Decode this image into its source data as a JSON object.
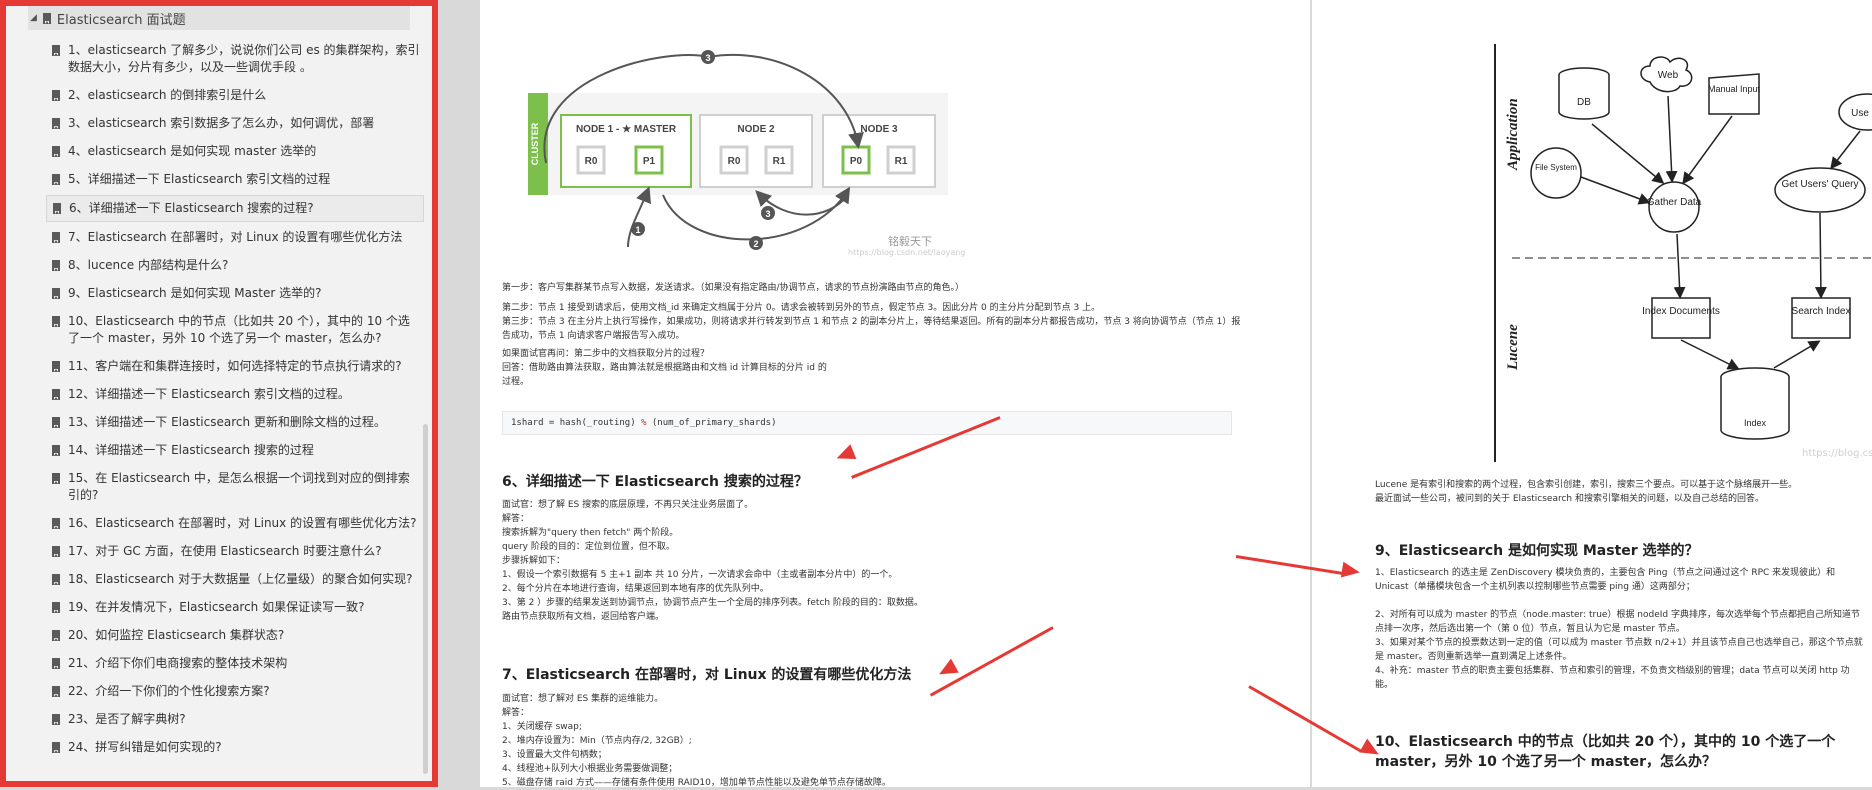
{
  "sidebar": {
    "header": "Elasticsearch 面试题",
    "items": [
      "1、elasticsearch 了解多少，说说你们公司 es 的集群架构，索引数据大小，分片有多少，以及一些调优手段 。",
      "2、elasticsearch 的倒排索引是什么",
      "3、elasticsearch 索引数据多了怎么办，如何调优，部署",
      "4、elasticsearch 是如何实现 master 选举的",
      "5、详细描述一下 Elasticsearch 索引文档的过程",
      "6、详细描述一下 Elasticsearch 搜索的过程?",
      "7、Elasticsearch 在部署时，对 Linux 的设置有哪些优化方法",
      "8、lucence 内部结构是什么?",
      "9、Elasticsearch 是如何实现 Master 选举的?",
      "10、Elasticsearch 中的节点（比如共 20 个），其中的 10 个选了一个 master，另外 10 个选了另一个 master，怎么办?",
      "11、客户端在和集群连接时，如何选择特定的节点执行请求的?",
      "12、详细描述一下 Elasticsearch 索引文档的过程。",
      "13、详细描述一下 Elasticsearch 更新和删除文档的过程。",
      "14、详细描述一下 Elasticsearch 搜索的过程",
      "15、在 Elasticsearch 中，是怎么根据一个词找到对应的倒排索引的?",
      "16、Elasticsearch 在部署时，对 Linux 的设置有哪些优化方法?",
      "17、对于 GC 方面，在使用 Elasticsearch 时要注意什么?",
      "18、Elasticsearch 对于大数据量（上亿量级）的聚合如何实现?",
      "19、在并发情况下，Elasticsearch 如果保证读写一致?",
      "20、如何监控 Elasticsearch 集群状态?",
      "21、介绍下你们电商搜索的整体技术架构",
      "22、介绍一下你们的个性化搜索方案?",
      "23、是否了解字典树?",
      "24、拼写纠错是如何实现的?"
    ]
  },
  "page1": {
    "diagram": {
      "cluster_label": "CLUSTER",
      "node1": "NODE 1 - ★ MASTER",
      "node2": "NODE 2",
      "node3": "NODE 3",
      "shards": [
        "R0",
        "P1",
        "R0",
        "R1",
        "P0",
        "R1"
      ],
      "steps": [
        "3",
        "1",
        "2",
        "3"
      ],
      "watermark": "铭毅天下",
      "watermark_url": "https://blog.csdn.net/laoyang"
    },
    "step1": "第一步：客户写集群某节点写入数据，发送请求。（如果没有指定路由/协调节点，请求的节点扮演路由节点的角色。）",
    "step2": "第二步：节点 1 接受到请求后，使用文档_id 来确定文档属于分片 0。请求会被转到另外的节点，假定节点 3。因此分片 0 的主分片分配到节点 3 上。",
    "step3": "第三步：节点 3 在主分片上执行写操作，如果成功，则将请求并行转发到节点 1 和节点 2 的副本分片上，等待结果返回。所有的副本分片都报告成功，节点 3 将向协调节点（节点 1）报告成功，节点 1 向请求客户端报告写入成功。",
    "qa1": "如果面试官再问：第二步中的文档获取分片的过程？",
    "qa2": "回答：借助路由算法获取，路由算法就是根据路由和文档 id 计算目标的分片 id 的",
    "qa3": "过程。",
    "code_prefix": "1shard = hash(_routing) ",
    "code_op": "%",
    "code_suffix": " (num_of_primary_shards)",
    "sec6_title": "6、详细描述一下 Elasticsearch 搜索的过程？",
    "sec6_lines": [
      "面试官：想了解 ES 搜索的底层原理，不再只关注业务层面了。",
      "解答：",
      "搜索拆解为\"query then fetch\" 两个阶段。",
      "query 阶段的目的：定位到位置，但不取。",
      "步骤拆解如下：",
      "1、假设一个索引数据有 5 主+1 副本 共 10 分片，一次请求会命中（主或者副本分片中）的一个。",
      "2、每个分片在本地进行查询，结果返回到本地有序的优先队列中。",
      "3、第 2 ）步骤的结果发送到协调节点，协调节点产生一个全局的排序列表。fetch 阶段的目的：取数据。",
      "路由节点获取所有文档，返回给客户端。"
    ],
    "sec7_title": "7、Elasticsearch 在部署时，对 Linux 的设置有哪些优化方法",
    "sec7_lines": [
      "面试官：想了解对 ES 集群的运维能力。",
      "解答：",
      "1、关闭缓存 swap;",
      "2、堆内存设置为：Min（节点内存/2, 32GB）;",
      "3、设置最大文件句柄数；",
      "4、线程池+队列大小根据业务需要做调整；",
      "5、磁盘存储 raid 方式——存储有条件使用 RAID10，增加单节点性能以及避免单节点存储故障。"
    ]
  },
  "page2": {
    "diagram": {
      "application": "Application",
      "lucene": "Lucene",
      "db": "DB",
      "web": "Web",
      "manual": "Manual Input",
      "file": "File System",
      "gather": "Gather Data",
      "users": "Get Users' Query",
      "use": "Use",
      "index_docs": "Index Documents",
      "search_index": "Search Index",
      "index": "Index",
      "watermark": "https://blog.csdn"
    },
    "intro1": "Lucene 是有索引和搜索的两个过程，包含索引创建，索引，搜索三个要点。可以基于这个脉络展开一些。",
    "intro2": "最近面试一些公司，被问到的关于 Elasticsearch 和搜索引擎相关的问题，以及自己总结的回答。",
    "sec9_title": "9、Elasticsearch 是如何实现 Master 选举的？",
    "sec9_lines": [
      "1、Elasticsearch 的选主是 ZenDiscovery 模块负责的，主要包含 Ping（节点之间通过这个 RPC 来发现彼此）和 Unicast（单播模块包含一个主机列表以控制哪些节点需要 ping 通）这两部分；",
      "",
      "2、对所有可以成为 master 的节点（node.master: true）根据 nodeId 字典排序，每次选举每个节点都把自己所知道节点排一次序，然后选出第一个（第 0 位）节点，暂且认为它是 master 节点。",
      "3、如果对某个节点的投票数达到一定的值（可以成为 master 节点数 n/2+1）并且该节点自己也选举自己，那这个节点就是 master。否则重新选举一直到满足上述条件。",
      "4、补充：master 节点的职责主要包括集群、节点和索引的管理，不负责文档级别的管理；data 节点可以关闭 http 功能。"
    ],
    "sec10_title": "10、Elasticsearch 中的节点（比如共 20 个），其中的 10 个选了一个 master，另外 10 个选了另一个 master，怎么办？"
  }
}
